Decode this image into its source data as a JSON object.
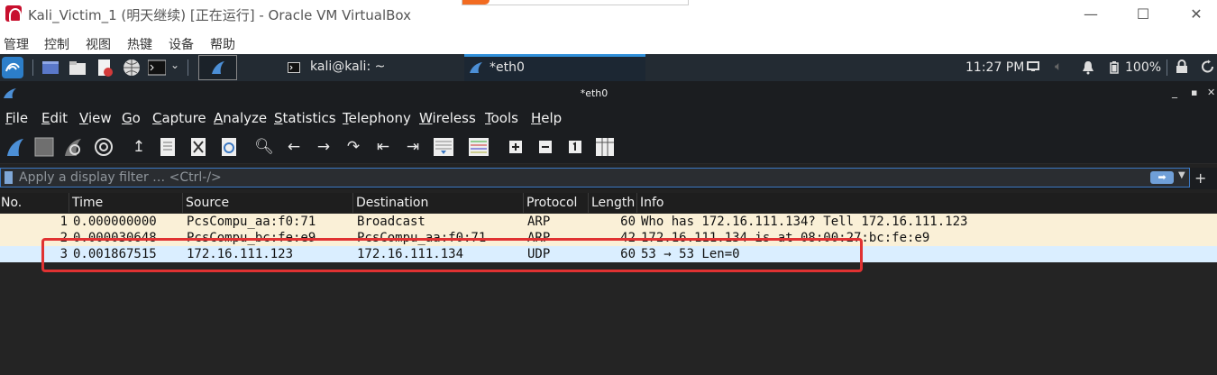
{
  "host_window": {
    "title": "Kali_Victim_1 (明天继续) [正在运行] - Oracle VM VirtualBox",
    "controls": {
      "minimize": "—",
      "maximize": "☐",
      "close": "✕"
    },
    "menu": [
      "管理",
      "控制",
      "视图",
      "热键",
      "设备",
      "帮助"
    ]
  },
  "panel": {
    "tasks": [
      {
        "label": "kali@kali: ~",
        "icon": "terminal-icon"
      },
      {
        "label": "*eth0",
        "icon": "wireshark-fin-icon",
        "active": true
      }
    ],
    "clock": "11:27 PM",
    "battery": "100%"
  },
  "wireshark": {
    "window_title": "*eth0",
    "window_controls": {
      "minimize": "_",
      "maximize": "▪",
      "close": "✕"
    },
    "menu": [
      "File",
      "Edit",
      "View",
      "Go",
      "Capture",
      "Analyze",
      "Statistics",
      "Telephony",
      "Wireless",
      "Tools",
      "Help"
    ],
    "filter": {
      "placeholder": "Apply a display filter … <Ctrl-/>",
      "value": ""
    },
    "columns": [
      "No.",
      "Time",
      "Source",
      "Destination",
      "Protocol",
      "Length",
      "Info"
    ],
    "packets": [
      {
        "no": "1",
        "time": "0.000000000",
        "source": "PcsCompu_aa:f0:71",
        "destination": "Broadcast",
        "protocol": "ARP",
        "length": "60",
        "info": "Who has 172.16.111.134? Tell 172.16.111.123"
      },
      {
        "no": "2",
        "time": "0.000030648",
        "source": "PcsCompu_bc:fe:e9",
        "destination": "PcsCompu_aa:f0:71",
        "protocol": "ARP",
        "length": "42",
        "info": "172.16.111.134 is at 08:00:27:bc:fe:e9"
      },
      {
        "no": "3",
        "time": "0.001867515",
        "source": "172.16.111.123",
        "destination": "172.16.111.134",
        "protocol": "UDP",
        "length": "60",
        "info": "53 → 53 Len=0"
      }
    ]
  },
  "colors": {
    "arp_row": "#faf0d7",
    "udp_row": "#daeeff",
    "highlight": "#e03232",
    "accent": "#2f8fd9"
  }
}
